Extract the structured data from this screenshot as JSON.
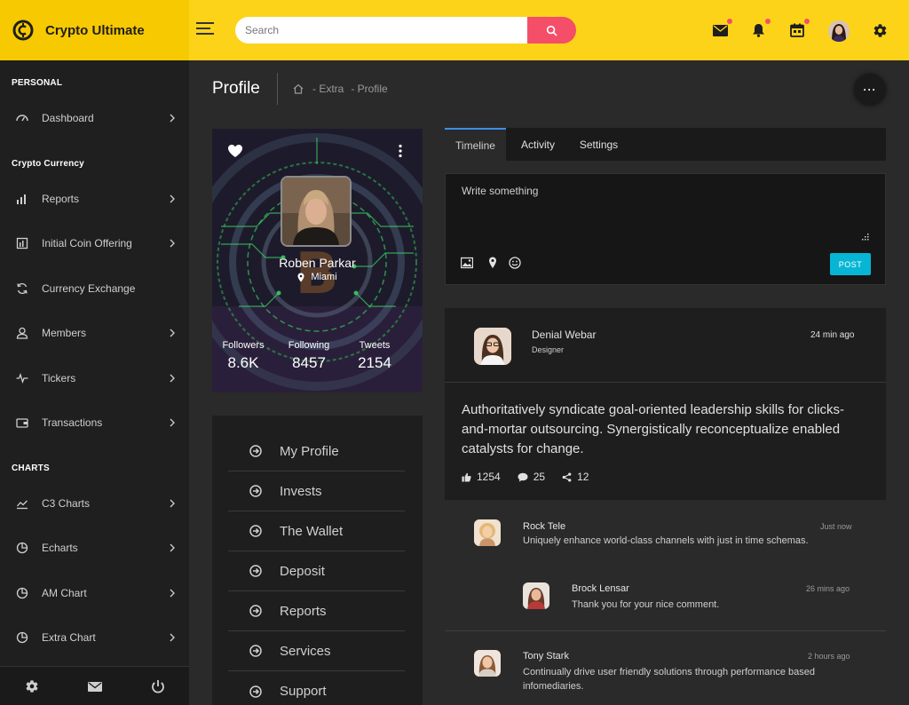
{
  "header": {
    "brand": "Crypto Ultimate",
    "search_placeholder": "Search"
  },
  "sidebar": {
    "sections": {
      "personal": "PERSONAL",
      "crypto": "Crypto Currency",
      "charts": "CHARTS"
    },
    "items": [
      {
        "label": "Dashboard"
      },
      {
        "label": "Reports"
      },
      {
        "label": "Initial Coin Offering"
      },
      {
        "label": "Currency Exchange"
      },
      {
        "label": "Members"
      },
      {
        "label": "Tickers"
      },
      {
        "label": "Transactions"
      },
      {
        "label": "C3 Charts"
      },
      {
        "label": "Echarts"
      },
      {
        "label": "AM Chart"
      },
      {
        "label": "Extra Chart"
      }
    ]
  },
  "page": {
    "title": "Profile",
    "breadcrumb": [
      "- Extra",
      "- Profile"
    ],
    "more_label": "···"
  },
  "profile": {
    "name": "Roben Parkar",
    "location": "Miami",
    "stats": [
      {
        "label": "Followers",
        "value": "8.6K"
      },
      {
        "label": "Following",
        "value": "8457"
      },
      {
        "label": "Tweets",
        "value": "2154"
      }
    ]
  },
  "menu": [
    {
      "label": "My Profile"
    },
    {
      "label": "Invests"
    },
    {
      "label": "The Wallet"
    },
    {
      "label": "Deposit"
    },
    {
      "label": "Reports"
    },
    {
      "label": "Services"
    },
    {
      "label": "Support"
    }
  ],
  "tabs": [
    {
      "label": "Timeline"
    },
    {
      "label": "Activity"
    },
    {
      "label": "Settings"
    }
  ],
  "composer": {
    "placeholder": "Write something",
    "post_label": "POST"
  },
  "post": {
    "author": "Denial Webar",
    "role": "Designer",
    "time": "24 min ago",
    "text": "Authoritatively syndicate goal-oriented leadership skills for clicks-and-mortar outsourcing. Synergistically reconceptualize enabled catalysts for change.",
    "likes": "1254",
    "comments": "25",
    "shares": "12"
  },
  "comments": [
    {
      "name": "Rock Tele",
      "time": "Just now",
      "text": "Uniquely enhance world-class channels with just in time schemas."
    },
    {
      "name": "Brock Lensar",
      "time": "26 mins ago",
      "text": "Thank you for your nice comment."
    },
    {
      "name": "Tony Stark",
      "time": "2 hours ago",
      "text": "Continually drive user friendly solutions through performance based infomediaries."
    }
  ],
  "colors": {
    "header": "#fdd31a",
    "brand_bg": "#f7c900",
    "search_button": "#f44e68",
    "post_button": "#06b6d4",
    "tab_active": "#3d8ee8"
  }
}
